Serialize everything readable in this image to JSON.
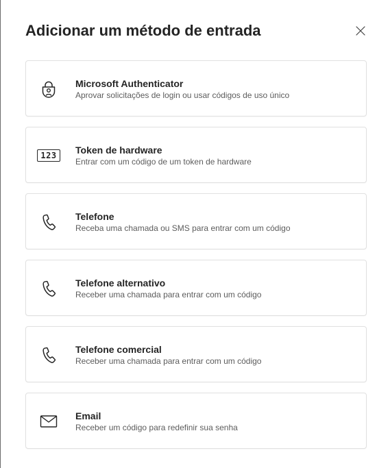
{
  "dialog": {
    "title": "Adicionar um método de entrada",
    "close_icon": "close-icon"
  },
  "methods": [
    {
      "id": "microsoft-authenticator",
      "icon": "authenticator-lock-icon",
      "title": "Microsoft Authenticator",
      "description": "Aprovar solicitações de login ou usar códigos de uso único"
    },
    {
      "id": "hardware-token",
      "icon": "hardware-token-icon",
      "icon_text": "123",
      "title": "Token de hardware",
      "description": "Entrar com um código de um token de hardware"
    },
    {
      "id": "phone",
      "icon": "phone-icon",
      "title": "Telefone",
      "description": "Receba uma chamada ou SMS para entrar com um código"
    },
    {
      "id": "alternate-phone",
      "icon": "phone-icon",
      "title": "Telefone alternativo",
      "description": "Receber uma chamada para entrar com um código"
    },
    {
      "id": "office-phone",
      "icon": "phone-icon",
      "title": "Telefone comercial",
      "description": "Receber uma chamada para entrar com um código"
    },
    {
      "id": "email",
      "icon": "mail-icon",
      "title": "Email",
      "description": "Receber um código para redefinir sua senha"
    }
  ],
  "colors": {
    "text_primary": "#242424",
    "text_secondary": "#5c5c5c",
    "card_border": "#e1e1e1"
  }
}
